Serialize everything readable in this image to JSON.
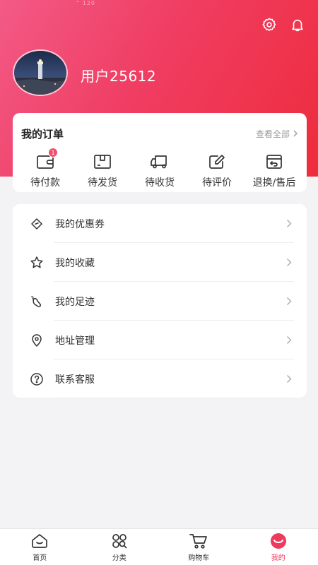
{
  "header": {
    "status_text": "“ 120",
    "username": "用户25612"
  },
  "orders": {
    "title": "我的订单",
    "view_all": "查看全部",
    "items": [
      {
        "label": "待付款",
        "badge": "1"
      },
      {
        "label": "待发货"
      },
      {
        "label": "待收货"
      },
      {
        "label": "待评价"
      },
      {
        "label": "退换/售后"
      }
    ]
  },
  "menu": {
    "items": [
      {
        "label": "我的优惠券",
        "icon": "coupon-icon"
      },
      {
        "label": "我的收藏",
        "icon": "star-icon"
      },
      {
        "label": "我的足迹",
        "icon": "footprint-icon"
      },
      {
        "label": "地址管理",
        "icon": "location-pin-icon"
      },
      {
        "label": "联系客服",
        "icon": "help-circle-icon"
      }
    ]
  },
  "tabbar": {
    "items": [
      {
        "label": "首页",
        "icon": "home-icon"
      },
      {
        "label": "分类",
        "icon": "category-icon"
      },
      {
        "label": "购物车",
        "icon": "cart-icon"
      },
      {
        "label": "我的",
        "icon": "profile-icon",
        "active": true
      }
    ]
  },
  "colors": {
    "brand": "#ee3a5d",
    "header_gradient_start": "#f25a86",
    "header_gradient_end": "#ee2c3c"
  }
}
